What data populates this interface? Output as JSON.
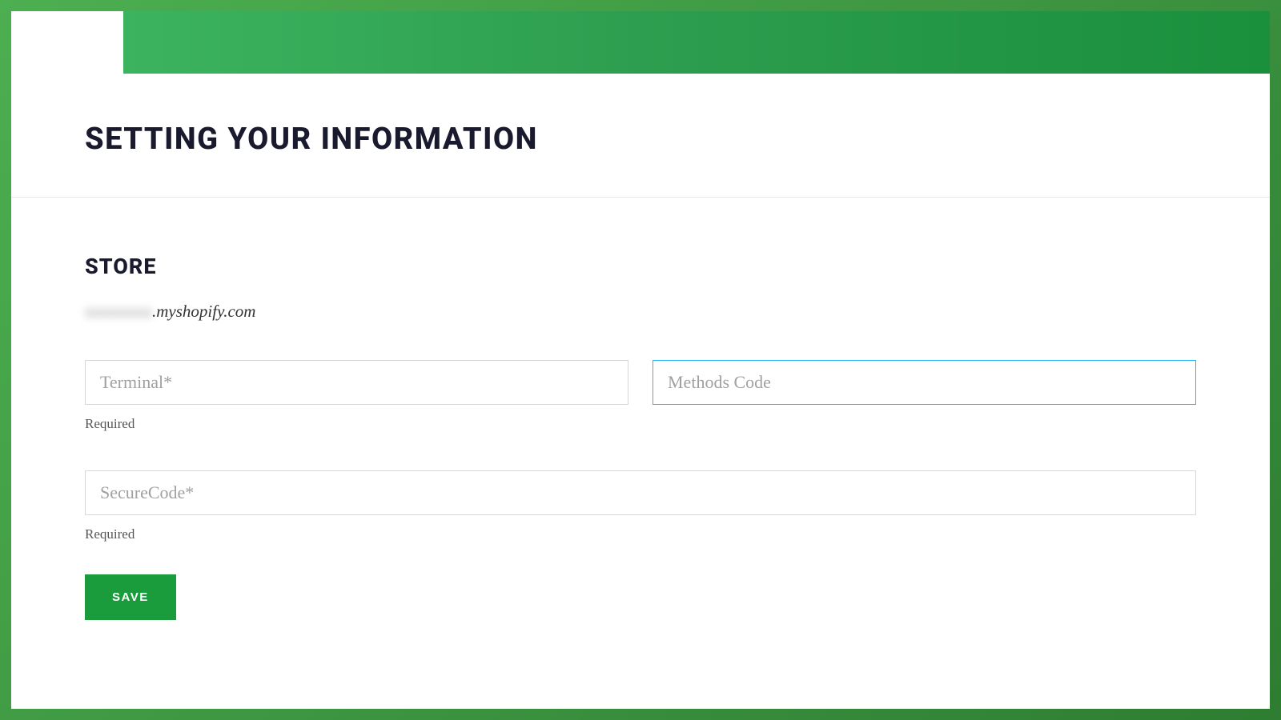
{
  "page": {
    "title": "SETTING YOUR INFORMATION"
  },
  "store": {
    "heading": "STORE",
    "domain_obscured": "xxxxxxxx",
    "domain_suffix": ".myshopify.com"
  },
  "form": {
    "terminal": {
      "placeholder": "Terminal*",
      "helper": "Required"
    },
    "methods_code": {
      "placeholder": "Methods Code"
    },
    "secure_code": {
      "placeholder": "SecureCode*",
      "helper": "Required"
    },
    "save_label": "SAVE"
  }
}
